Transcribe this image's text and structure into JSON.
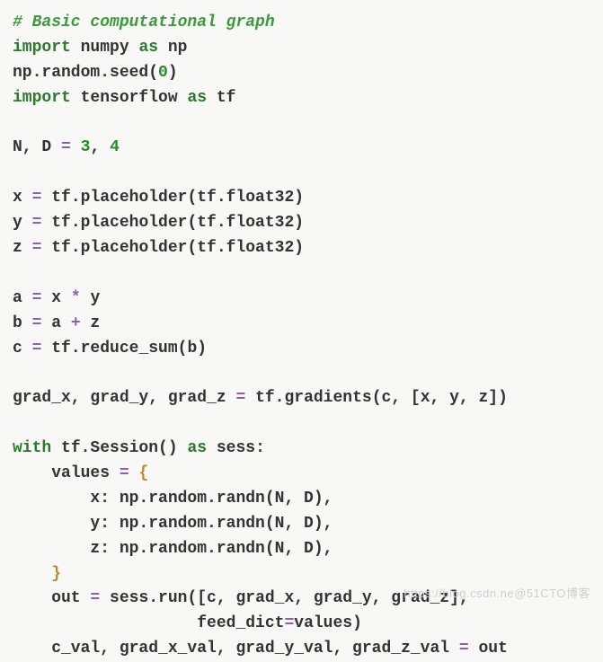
{
  "code": {
    "l1_comment": "# Basic computational graph",
    "l2_import": "import",
    "l2_rest": " numpy ",
    "l2_as": "as",
    "l2_np": " np",
    "l3": "np.random.seed(",
    "l3_num": "0",
    "l3_end": ")",
    "l4_import": "import",
    "l4_rest": " tensorflow ",
    "l4_as": "as",
    "l4_tf": " tf",
    "l6_part1": "N, D ",
    "l6_op": "=",
    "l6_sp": " ",
    "l6_num1": "3",
    "l6_comma": ", ",
    "l6_num2": "4",
    "l8_x": "x ",
    "l8_eq": "=",
    "l8_rest": " tf.placeholder(tf.float32)",
    "l9_y": "y ",
    "l9_eq": "=",
    "l9_rest": " tf.placeholder(tf.float32)",
    "l10_z": "z ",
    "l10_eq": "=",
    "l10_rest": " tf.placeholder(tf.float32)",
    "l12_a": "a ",
    "l12_eq": "=",
    "l12_mid": " x ",
    "l12_star": "*",
    "l12_end": " y",
    "l13_b": "b ",
    "l13_eq": "=",
    "l13_mid": " a ",
    "l13_plus": "+",
    "l13_end": " z",
    "l14_c": "c ",
    "l14_eq": "=",
    "l14_rest": " tf.reduce_sum(b)",
    "l16_part1": "grad_x, grad_y, grad_z ",
    "l16_eq": "=",
    "l16_rest": " tf.gradients(c, [x, y, z])",
    "l18_with": "with",
    "l18_mid": " tf.Session() ",
    "l18_as": "as",
    "l18_end": " sess:",
    "l19_indent": "    values ",
    "l19_eq": "=",
    "l19_sp": " ",
    "l19_brace": "{",
    "l20": "        x: np.random.randn(N, D),",
    "l21": "        y: np.random.randn(N, D),",
    "l22": "        z: np.random.randn(N, D),",
    "l23_indent": "    ",
    "l23_brace": "}",
    "l24_part1": "    out ",
    "l24_eq": "=",
    "l24_rest": " sess.run([c, grad_x, grad_y, grad_z],",
    "l25": "                   feed_dict",
    "l25_eq": "=",
    "l25_end": "values)",
    "l26_part1": "    c_val, grad_x_val, grad_y_val, grad_z_val ",
    "l26_eq": "=",
    "l26_end": " out"
  },
  "watermark": "https://blog.csdn.ne@51CTO博客"
}
